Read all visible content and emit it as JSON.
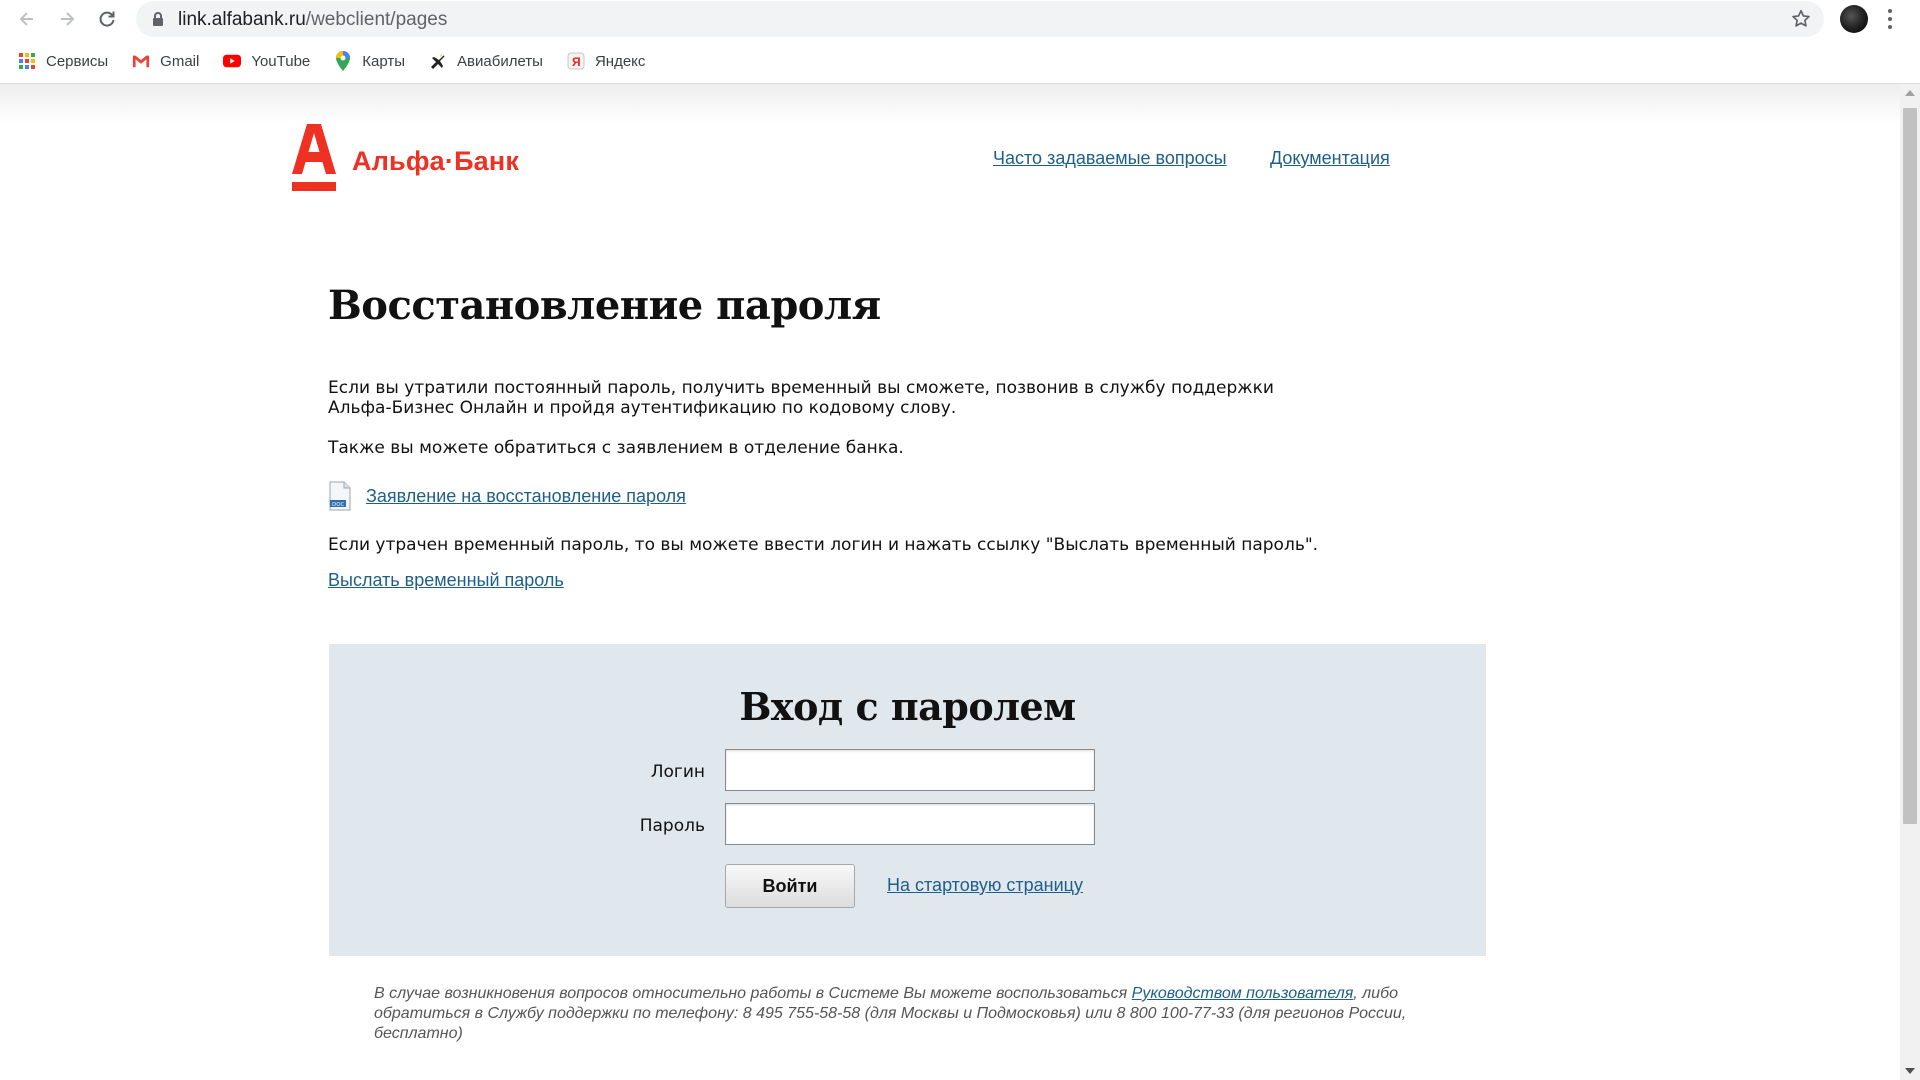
{
  "browser": {
    "url_host": "link.alfabank.ru",
    "url_path": "/webclient/pages",
    "bookmarks": [
      {
        "label": "Сервисы",
        "icon": "apps-grid-icon"
      },
      {
        "label": "Gmail",
        "icon": "gmail-icon"
      },
      {
        "label": "YouTube",
        "icon": "youtube-icon"
      },
      {
        "label": "Карты",
        "icon": "maps-pin-icon"
      },
      {
        "label": "Авиабилеты",
        "icon": "plane-icon"
      },
      {
        "label": "Яндекс",
        "icon": "yandex-icon"
      }
    ]
  },
  "header": {
    "logo_text": "Альфа·Банк",
    "faq_link": "Часто задаваемые вопросы",
    "docs_link": "Документация"
  },
  "recovery": {
    "title": "Восстановление пароля",
    "para1": "Если вы утратили постоянный пароль, получить временный вы сможете, позвонив в службу поддержки Альфа-Бизнес Онлайн и пройдя аутентификацию по кодовому слову.",
    "para2": "Также вы можете обратиться с заявлением в отделение банка.",
    "doc_link": "Заявление на восстановление пароля",
    "para3": "Если утрачен временный пароль, то вы можете ввести логин и нажать ссылку \"Выслать временный пароль\".",
    "send_link": "Выслать временный пароль"
  },
  "login": {
    "title": "Вход с паролем",
    "login_label": "Логин",
    "login_value": "",
    "password_label": "Пароль",
    "password_value": "",
    "submit": "Войти",
    "home_link": "На стартовую страницу"
  },
  "footer": {
    "text_before": "В случае возникновения вопросов относительно работы в Системе Вы можете воспользоваться ",
    "guide_link": "Руководством пользователя",
    "text_after": ", либо обратиться в Службу поддержки по телефону: 8 495 755-58-58 (для Москвы и Подмосковья) или 8 800 100-77-33 (для регионов России, бесплатно)"
  },
  "colors": {
    "brand_red": "#ef3124",
    "link_blue": "#1d5f8a",
    "login_panel_bg": "#e1e8ed"
  }
}
